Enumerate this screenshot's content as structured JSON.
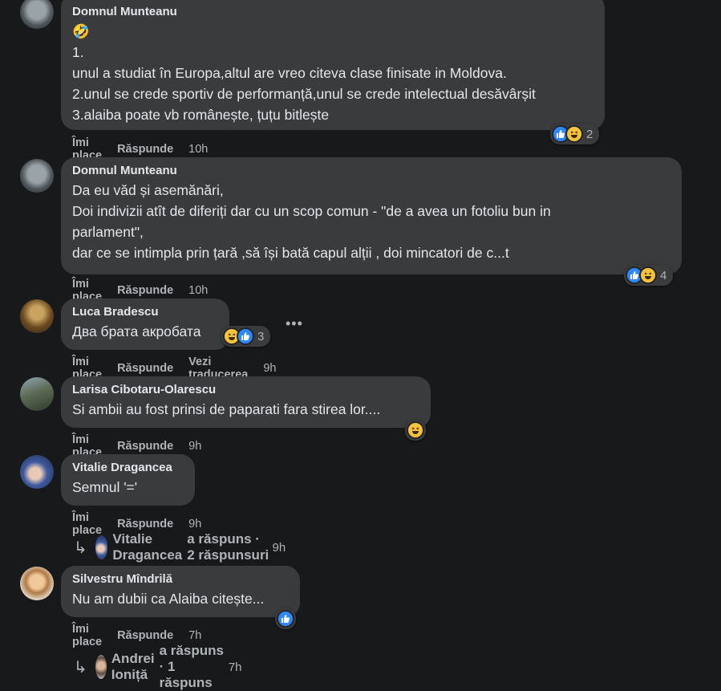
{
  "comments": [
    {
      "author": "Domnul Munteanu",
      "lines": [
        "🤣",
        "1.",
        "unul a studiat în Europa,altul are vreo citeva clase finisate in Moldova.",
        "2.unul se crede sportiv de performanță,unul se crede intelectual desăvârșit",
        "3.alaiba poate vb românește, țuțu bitlește"
      ],
      "like_label": "Îmi place",
      "reply_label": "Răspunde",
      "time": "10h",
      "reaction_count": "2"
    },
    {
      "author": "Domnul Munteanu",
      "lines": [
        "Da eu văd și asemănări,",
        "Doi indivizii atît de diferiți dar cu un scop comun - \"de a avea un fotoliu bun in",
        "parlament\",",
        "dar ce se intimpla prin țară ,să își bată capul alții , doi mincatori de c...t"
      ],
      "like_label": "Îmi place",
      "reply_label": "Răspunde",
      "time": "10h",
      "reaction_count": "4"
    },
    {
      "author": "Luca Bradescu",
      "lines": [
        "Два брата акробата"
      ],
      "like_label": "Îmi place",
      "reply_label": "Răspunde",
      "translate_label": "Vezi traducerea",
      "time": "9h",
      "reaction_count": "3",
      "more": "•••"
    },
    {
      "author": "Larisa Cibotaru-Olarescu",
      "lines": [
        "Si ambii au fost prinsi de paparati fara stirea lor...."
      ],
      "like_label": "Îmi place",
      "reply_label": "Răspunde",
      "time": "9h"
    },
    {
      "author": "Vitalie Dragancea",
      "lines": [
        "Semnul '='"
      ],
      "like_label": "Îmi place",
      "reply_label": "Răspunde",
      "time": "9h",
      "replies": {
        "name": "Vitalie Dragancea",
        "text": "a răspuns · 2 răspunsuri",
        "time": "9h"
      }
    },
    {
      "author": "Silvestru Mîndrilă",
      "lines": [
        "Nu am dubii ca Alaiba citește..."
      ],
      "like_label": "Îmi place",
      "reply_label": "Răspunde",
      "time": "7h",
      "replies": {
        "name": "Andrei Ioniță",
        "text": "a răspuns · 1 răspuns",
        "time": "7h"
      }
    }
  ],
  "icons": {
    "like": "like-reaction-icon",
    "haha": "haha-reaction-icon",
    "reply": "reply-arrow-icon"
  },
  "colors": {
    "background": "#18191a",
    "bubble": "#3a3b3c",
    "like": "#2d88ff",
    "haha": "#f7c23d",
    "muted": "#b0b3b8"
  }
}
